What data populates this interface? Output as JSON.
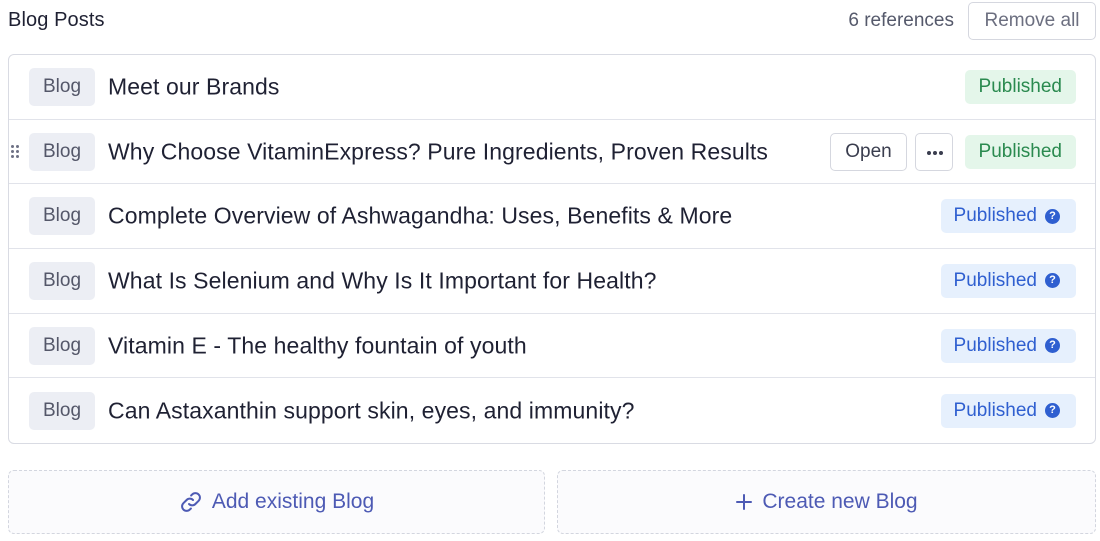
{
  "header": {
    "title": "Blog Posts",
    "references": "6 references",
    "remove_all": "Remove all"
  },
  "rows": [
    {
      "type": "Blog",
      "title": "Meet our Brands",
      "status": "Published",
      "status_style": "green"
    },
    {
      "type": "Blog",
      "title": "Why Choose VitaminExpress? Pure Ingredients, Proven Results",
      "status": "Published",
      "status_style": "green",
      "hovered": true,
      "open_label": "Open"
    },
    {
      "type": "Blog",
      "title": "Complete Overview of Ashwagandha: Uses, Benefits & More",
      "status": "Published",
      "status_style": "blue"
    },
    {
      "type": "Blog",
      "title": "What Is Selenium and Why Is It Important for Health?",
      "status": "Published",
      "status_style": "blue"
    },
    {
      "type": "Blog",
      "title": "Vitamin E - The healthy fountain of youth",
      "status": "Published",
      "status_style": "blue"
    },
    {
      "type": "Blog",
      "title": "Can Astaxanthin support skin, eyes, and immunity?",
      "status": "Published",
      "status_style": "blue"
    }
  ],
  "actions": {
    "add_existing": "Add existing Blog",
    "create_new": "Create new Blog"
  },
  "colors": {
    "published_green_text": "#2a8a4f",
    "published_green_bg": "#e4f6ea",
    "published_blue_text": "#2f5fd0",
    "published_blue_bg": "#e6f0fd",
    "action_text": "#4d5ab4"
  }
}
